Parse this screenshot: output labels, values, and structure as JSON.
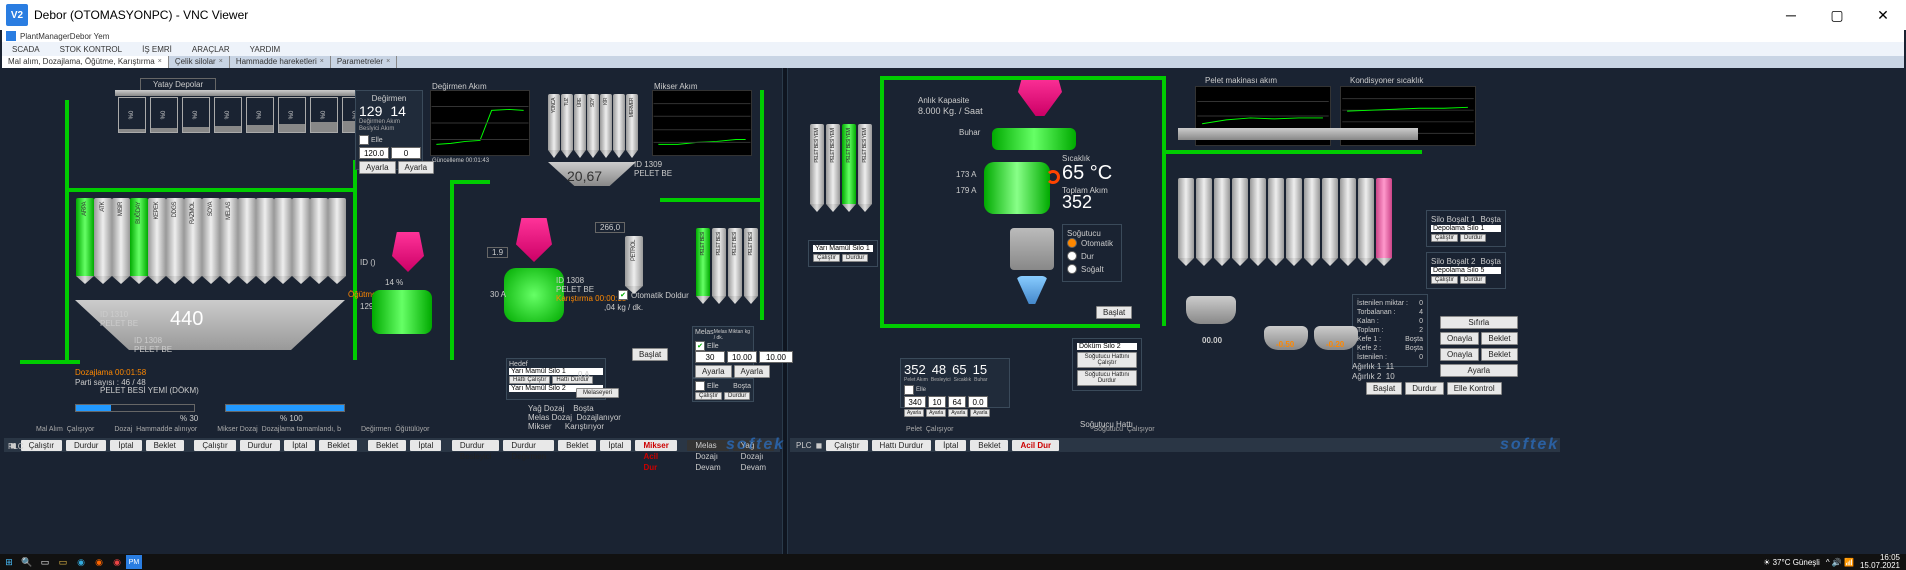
{
  "window": {
    "title": "Debor (OTOMASYONPC) - VNC Viewer",
    "vnc_badge": "V2"
  },
  "app": {
    "title": "PlantManagerDebor Yem"
  },
  "menu": [
    "SCADA",
    "STOK KONTROL",
    "İŞ EMRİ",
    "ARAÇLAR",
    "YARDIM"
  ],
  "tabs": [
    {
      "label": "Mal alım, Dozajlama, Öğütme, Karıştırma",
      "active": true
    },
    {
      "label": "Çelik silolar",
      "active": false
    },
    {
      "label": "Hammadde hareketleri",
      "active": false
    },
    {
      "label": "Parametreler",
      "active": false
    }
  ],
  "top_bins_label": "Yatay Depolar",
  "top_bins": [
    {
      "name": "%0"
    },
    {
      "name": "%0"
    },
    {
      "name": "%0"
    },
    {
      "name": "%0"
    },
    {
      "name": "%0"
    },
    {
      "name": "%0"
    },
    {
      "name": "%0"
    },
    {
      "name": "%0"
    }
  ],
  "degirmen": {
    "title": "Değirmen",
    "val1": "129",
    "val2": "14",
    "sub": "Değirmen Akım Beslyici Akım",
    "setA": "120.0",
    "setB": "0",
    "btnA": "Ayarla",
    "btnB": "Ayarla",
    "elle": "Elle"
  },
  "degirmen_chart": {
    "title": "Değirmen Akım",
    "time_label": "Güncelleme 00:01:43",
    "ylim": [
      100,
      400
    ],
    "grid": [
      100,
      200,
      300,
      400
    ],
    "xticks": [
      "33.00",
      "34.00",
      "35.00",
      "36.00"
    ]
  },
  "mikser_chart": {
    "title": "Mikser Akım",
    "ylim": [
      0,
      100
    ],
    "grid": [
      0,
      20,
      40,
      60,
      80,
      100
    ],
    "xticks": [
      "33.00",
      "34.00",
      "35.00",
      "36.00"
    ]
  },
  "scale": {
    "value": "20,67"
  },
  "pelet_id": {
    "id": "ID",
    "num": "1309",
    "name": "PELET BE"
  },
  "main_hopper": {
    "id": "ID",
    "num": "1310",
    "name": "PELET BE",
    "weight": "440",
    "id2_num": "1308",
    "id2_name": "PELET BE"
  },
  "dozajlama": {
    "label": "Dozajlama 00:01:58",
    "parti": "Parti sayısı : 46 / 48",
    "urun": "PELET BESİ YEMİ (DÖKM)"
  },
  "progress": {
    "a_pct": "% 30",
    "b_pct": "% 100"
  },
  "status_left": {
    "a": "Mal Alım",
    "a2": "Çalışıyor",
    "b": "Dozaj",
    "b2": "Hammadde alınıyor",
    "c": "Mikser Dozaj",
    "c2": "Dozajlama tamamlandı, b",
    "d": "Değirmen",
    "d2": "Öğütülüyor"
  },
  "ogutme": {
    "label": "Öğütme 00:01:57",
    "pct": "14 %",
    "amp": "129 A",
    "id": "ID ()"
  },
  "mixer": {
    "a": "30 A",
    "ratio": "1.9",
    "id": "ID 1308",
    "name": "PELET BE",
    "karis": "Karıştırma 00:00:18"
  },
  "mixer_rate": {
    "val": ",04 kg / dk.",
    "chk_label": "Otomatik Doldur",
    "btn": "Başlat"
  },
  "melas": {
    "title": "Melas",
    "col2": "Melas Miktarı kg / dk.",
    "elle": "Elle",
    "v1": "30",
    "v2": "10.00",
    "v3": "10.00",
    "ayarla": "Ayarla"
  },
  "hedef": {
    "title": "Hedef",
    "line1": "Yarı Mamül Silo 1",
    "line2": "Yarı Mamül Silo 2",
    "toz": "0 A",
    "btn_metle": "Melaseyeri"
  },
  "hedef_extra": {
    "r1a": "Yağ Dozaj",
    "r1b": "Boşta",
    "r2a": "Melas Dozaj",
    "r2b": "Dozajlanıyor",
    "r3a": "Mikser",
    "r3b": "Karıştırıyor"
  },
  "liq_tank": {
    "val": "266,0",
    "name": "PETROL",
    "sub": "Yağ"
  },
  "liq_controls": {
    "elle": "Elle",
    "hatti": "Hattı Çalıştır",
    "durdur": "Hattı Durdur",
    "basla": "Başlat",
    "bosta": "Boşta"
  },
  "left_buttons": [
    "Çalıştır",
    "Durdur",
    "İptal",
    "Beklet",
    "",
    "Çalıştır",
    "Durdur",
    "İptal",
    "Beklet",
    "",
    "Beklet",
    "İptal",
    "",
    "Durdur Besleyici",
    "Durdur Değirmen",
    "Beklet",
    "İptal"
  ],
  "left_extra_buttons": {
    "a": "Mikser Acil Dur",
    "b": "Melas Dozajı Devam",
    "c": "Yağ Dozajı Devam"
  },
  "right_top_charts": {
    "a": {
      "title": "Pelet makinası akım",
      "ylim": [
        0,
        400
      ],
      "grid": [
        0,
        100,
        200,
        300,
        400
      ],
      "xticks": [
        "34.00",
        "35.00",
        "36.00"
      ]
    },
    "b": {
      "title": "Kondisyoner sıcaklık",
      "ylim": [
        0,
        100
      ],
      "grid": [
        0,
        20,
        40,
        60,
        80,
        100
      ],
      "xticks": [
        "34.00",
        "35.00",
        "36.00"
      ]
    }
  },
  "kapasite": {
    "label": "Anlık Kapasite",
    "val": "8.000",
    "unit": "Kg. / Saat"
  },
  "buhar": "Buhar",
  "temp": {
    "label": "Sıcaklık",
    "val": "65 °C",
    "toplam": "Toplam Akım",
    "tval": "352"
  },
  "amps": {
    "a": "173 A",
    "b": "179 A"
  },
  "sogutucu": {
    "title": "Soğutucu",
    "opts": [
      "Otomatik",
      "Dur",
      "Soğalt"
    ],
    "sel": 0
  },
  "sogutucu_btns": {
    "a": "Soğutucu Hattını Çalıştır",
    "b": "Soğutucu Hattını Durdur",
    "combo": "Döküm Silo 2"
  },
  "baslat_btn": "Başlat",
  "readouts": {
    "cols": [
      "352",
      "48",
      "65",
      "15"
    ],
    "labels": [
      "Pelet Akım",
      "Besleyici",
      "Sıcaklık",
      "Buhar"
    ],
    "row2": [
      "340",
      "10",
      "64",
      "0.0"
    ],
    "row2_btn": "Ayarla"
  },
  "hedef2": {
    "title": "Hedef",
    "combo": "Yarı Mamül Silo 1",
    "c": "Çalıştır",
    "d": "Durdur"
  },
  "right_silos_label": {
    "a": "Silo Boşalt 1",
    "b": "Silo Boşalt 2",
    "combo": "Depolama Silo 1",
    "combo2": "Depolama Silo 5",
    "bos": "Boşta",
    "cal": "Çalıştır",
    "dur": "Durdur"
  },
  "torba": {
    "rows": [
      {
        "l": "İstenilen miktar :",
        "v": "0"
      },
      {
        "l": "Torbalanan :",
        "v": "4"
      },
      {
        "l": "Kalan :",
        "v": "0"
      },
      {
        "l": "Toplam :",
        "v": "2"
      },
      {
        "l": "Kefe 1 :",
        "v": "Boşta"
      },
      {
        "l": "Kefe 2 :",
        "v": "Boşta"
      },
      {
        "l": "İstenilen :",
        "v": "0"
      }
    ],
    "btns": [
      "Sıfırla",
      "Onayla",
      "Beklet",
      "Onayla",
      "Beklet",
      "Ayarla"
    ],
    "bottom": [
      "Başlat",
      "Durdur",
      "Elle Kontrol"
    ]
  },
  "agirlik": {
    "a": "Ağırlık 1",
    "b": "Ağırlık 2",
    "va": "11",
    "vb": "10"
  },
  "pans": {
    "a": "00.00",
    "b": "-0.50",
    "c": "-0.20"
  },
  "right_status": {
    "a": "Pelet",
    "a2": "Çalışıyor",
    "b": "Soğutucu",
    "b2": "Soğutucu Hattı",
    "c": "Çalışıyor"
  },
  "right_buttons": [
    "Çalıştır",
    "Hattı Durdur",
    "İptal",
    "Beklet"
  ],
  "right_acil": "Acil Dur",
  "softek": "softek",
  "plc": "PLC",
  "taskbar": {
    "weather": "37°C Güneşli",
    "time1": "16:05",
    "date1": "15.07.2021",
    "time2": "16:05",
    "date2": "15.07.2021"
  },
  "chart_data": [
    {
      "type": "line",
      "title": "Değirmen Akım",
      "x": [
        33.0,
        33.5,
        34.0,
        34.5,
        35.0,
        35.5,
        36.0
      ],
      "values": [
        120,
        122,
        125,
        128,
        260,
        265,
        260
      ],
      "ylim": [
        100,
        400
      ]
    },
    {
      "type": "line",
      "title": "Mikser Akım",
      "x": [
        33.0,
        33.5,
        34.0,
        34.5,
        35.0,
        35.5,
        36.0
      ],
      "values": [
        20,
        20,
        22,
        23,
        24,
        25,
        25
      ],
      "ylim": [
        0,
        100
      ]
    },
    {
      "type": "line",
      "title": "Pelet makinası akım",
      "x": [
        34.0,
        34.5,
        35.0,
        35.5,
        36.0
      ],
      "values": [
        180,
        200,
        210,
        205,
        210
      ],
      "ylim": [
        0,
        400
      ]
    },
    {
      "type": "line",
      "title": "Kondisyoner sıcaklık",
      "x": [
        34.0,
        34.5,
        35.0,
        35.5,
        36.0
      ],
      "values": [
        60,
        62,
        63,
        64,
        65
      ],
      "ylim": [
        0,
        100
      ]
    }
  ]
}
